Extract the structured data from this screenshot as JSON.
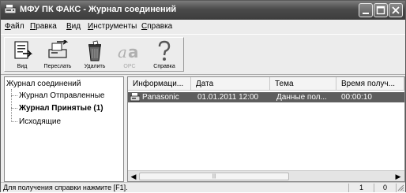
{
  "window": {
    "title": "МФУ ПК ФАКС - Журнал соединений"
  },
  "menu": [
    {
      "label_acc": "Ф",
      "label_rest": "айл"
    },
    {
      "label_acc": "П",
      "label_rest": "равка"
    },
    {
      "label_acc": "В",
      "label_rest": "ид"
    },
    {
      "label_acc": "И",
      "label_rest": "нструменты"
    },
    {
      "label_acc": "С",
      "label_rest": "правка"
    }
  ],
  "toolbar": {
    "view": "Вид",
    "forward": "Переслать",
    "delete": "Удалить",
    "ocr": "OPC",
    "help": "Справка"
  },
  "tree": {
    "root": "Журнал соединений",
    "sent": "Журнал Отправленные",
    "received": "Журнал Принятые (1)",
    "outgoing": "Исходящие"
  },
  "list": {
    "columns": [
      "Информаци...",
      "Дата",
      "Тема",
      "Время получ..."
    ],
    "rows": [
      {
        "info": "Panasonic",
        "date": "01.01.2011 12:00",
        "subject": "Данные пол...",
        "time": "00:00:10"
      }
    ]
  },
  "status": {
    "text": "Для получения справки нажмите [F1].",
    "count": "1",
    "unread": "0"
  }
}
